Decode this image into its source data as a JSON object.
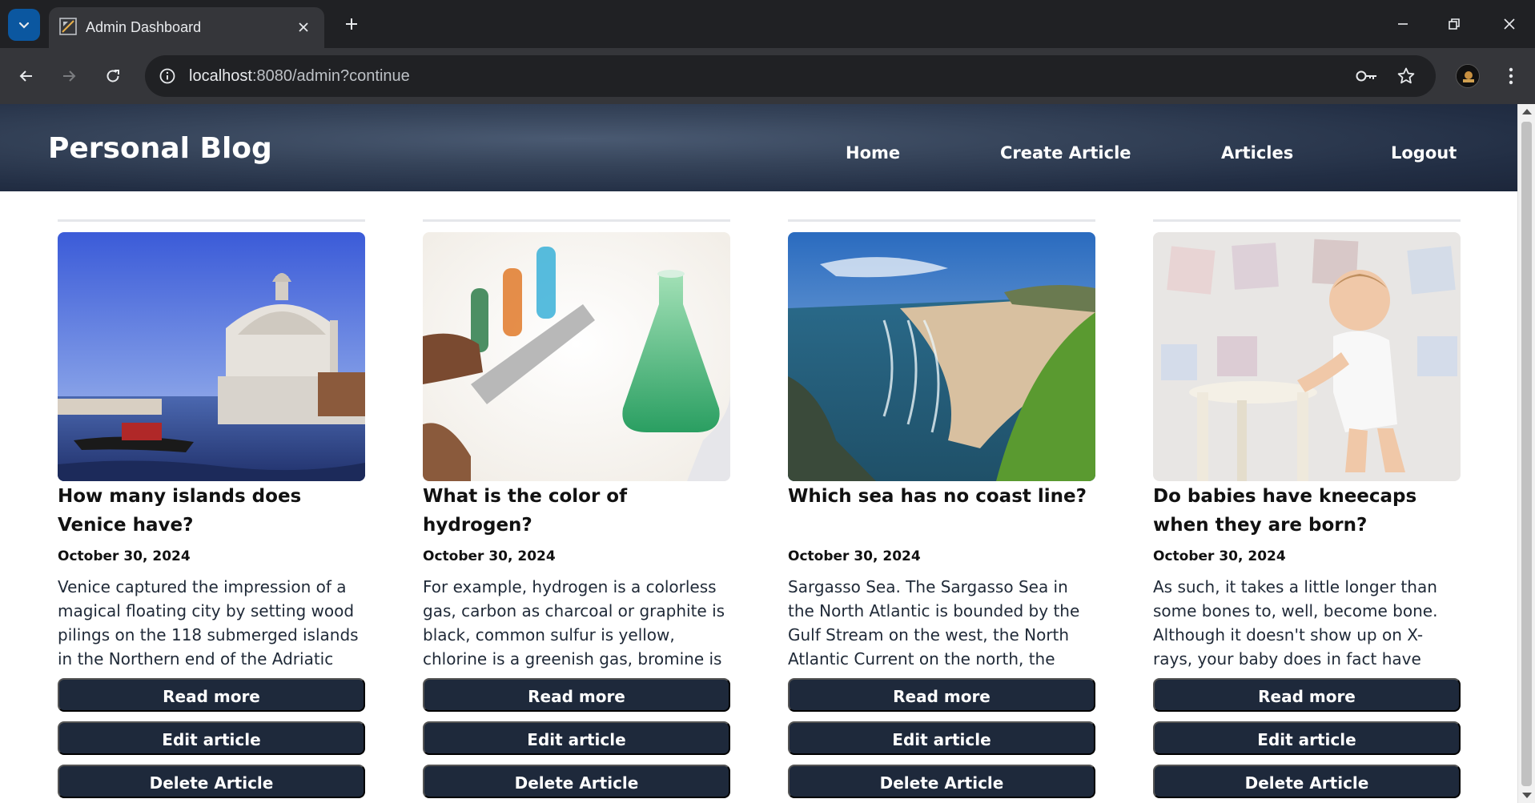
{
  "browser": {
    "tab_title": "Admin Dashboard",
    "url_host": "localhost",
    "url_rest": ":8080/admin?continue"
  },
  "site": {
    "title": "Personal Blog",
    "nav": [
      "Home",
      "Create Article",
      "Articles",
      "Logout"
    ]
  },
  "articles": [
    {
      "title": "How many islands does Venice have?",
      "date": "October 30, 2024",
      "excerpt": "Venice captured the impression of a magical floating city by setting wood pilings on the 118 submerged islands in the Northern end of the Adriatic Sea.",
      "image": "venice-photo"
    },
    {
      "title": "What is the color of hydrogen?",
      "date": "October 30, 2024",
      "excerpt": "For example, hydrogen is a colorless gas, carbon as charcoal or graphite is black, common sulfur is yellow, chlorine is a greenish gas, bromine is a dark red",
      "image": "test-tubes-photo"
    },
    {
      "title": "Which sea has no coast line?",
      "date": "October 30, 2024",
      "excerpt": "Sargasso Sea. The Sargasso Sea in the North Atlantic is bounded by the Gulf Stream on the west, the North Atlantic Current on the north, the Canary Current",
      "image": "coastline-photo"
    },
    {
      "title": "Do babies have kneecaps when they are born?",
      "date": "October 30, 2024",
      "excerpt": "As such, it takes a little longer than some bones to, well, become bone. Although it doesn't show up on X-rays, your baby does in fact have kneecaps. They're just",
      "image": "baby-photo"
    }
  ],
  "buttons": {
    "read": "Read more",
    "edit": "Edit article",
    "delete": "Delete Article"
  },
  "colors": {
    "button_bg": "#1e293b",
    "header_bg": "#2c3a50",
    "chrome_bg": "#202124"
  }
}
